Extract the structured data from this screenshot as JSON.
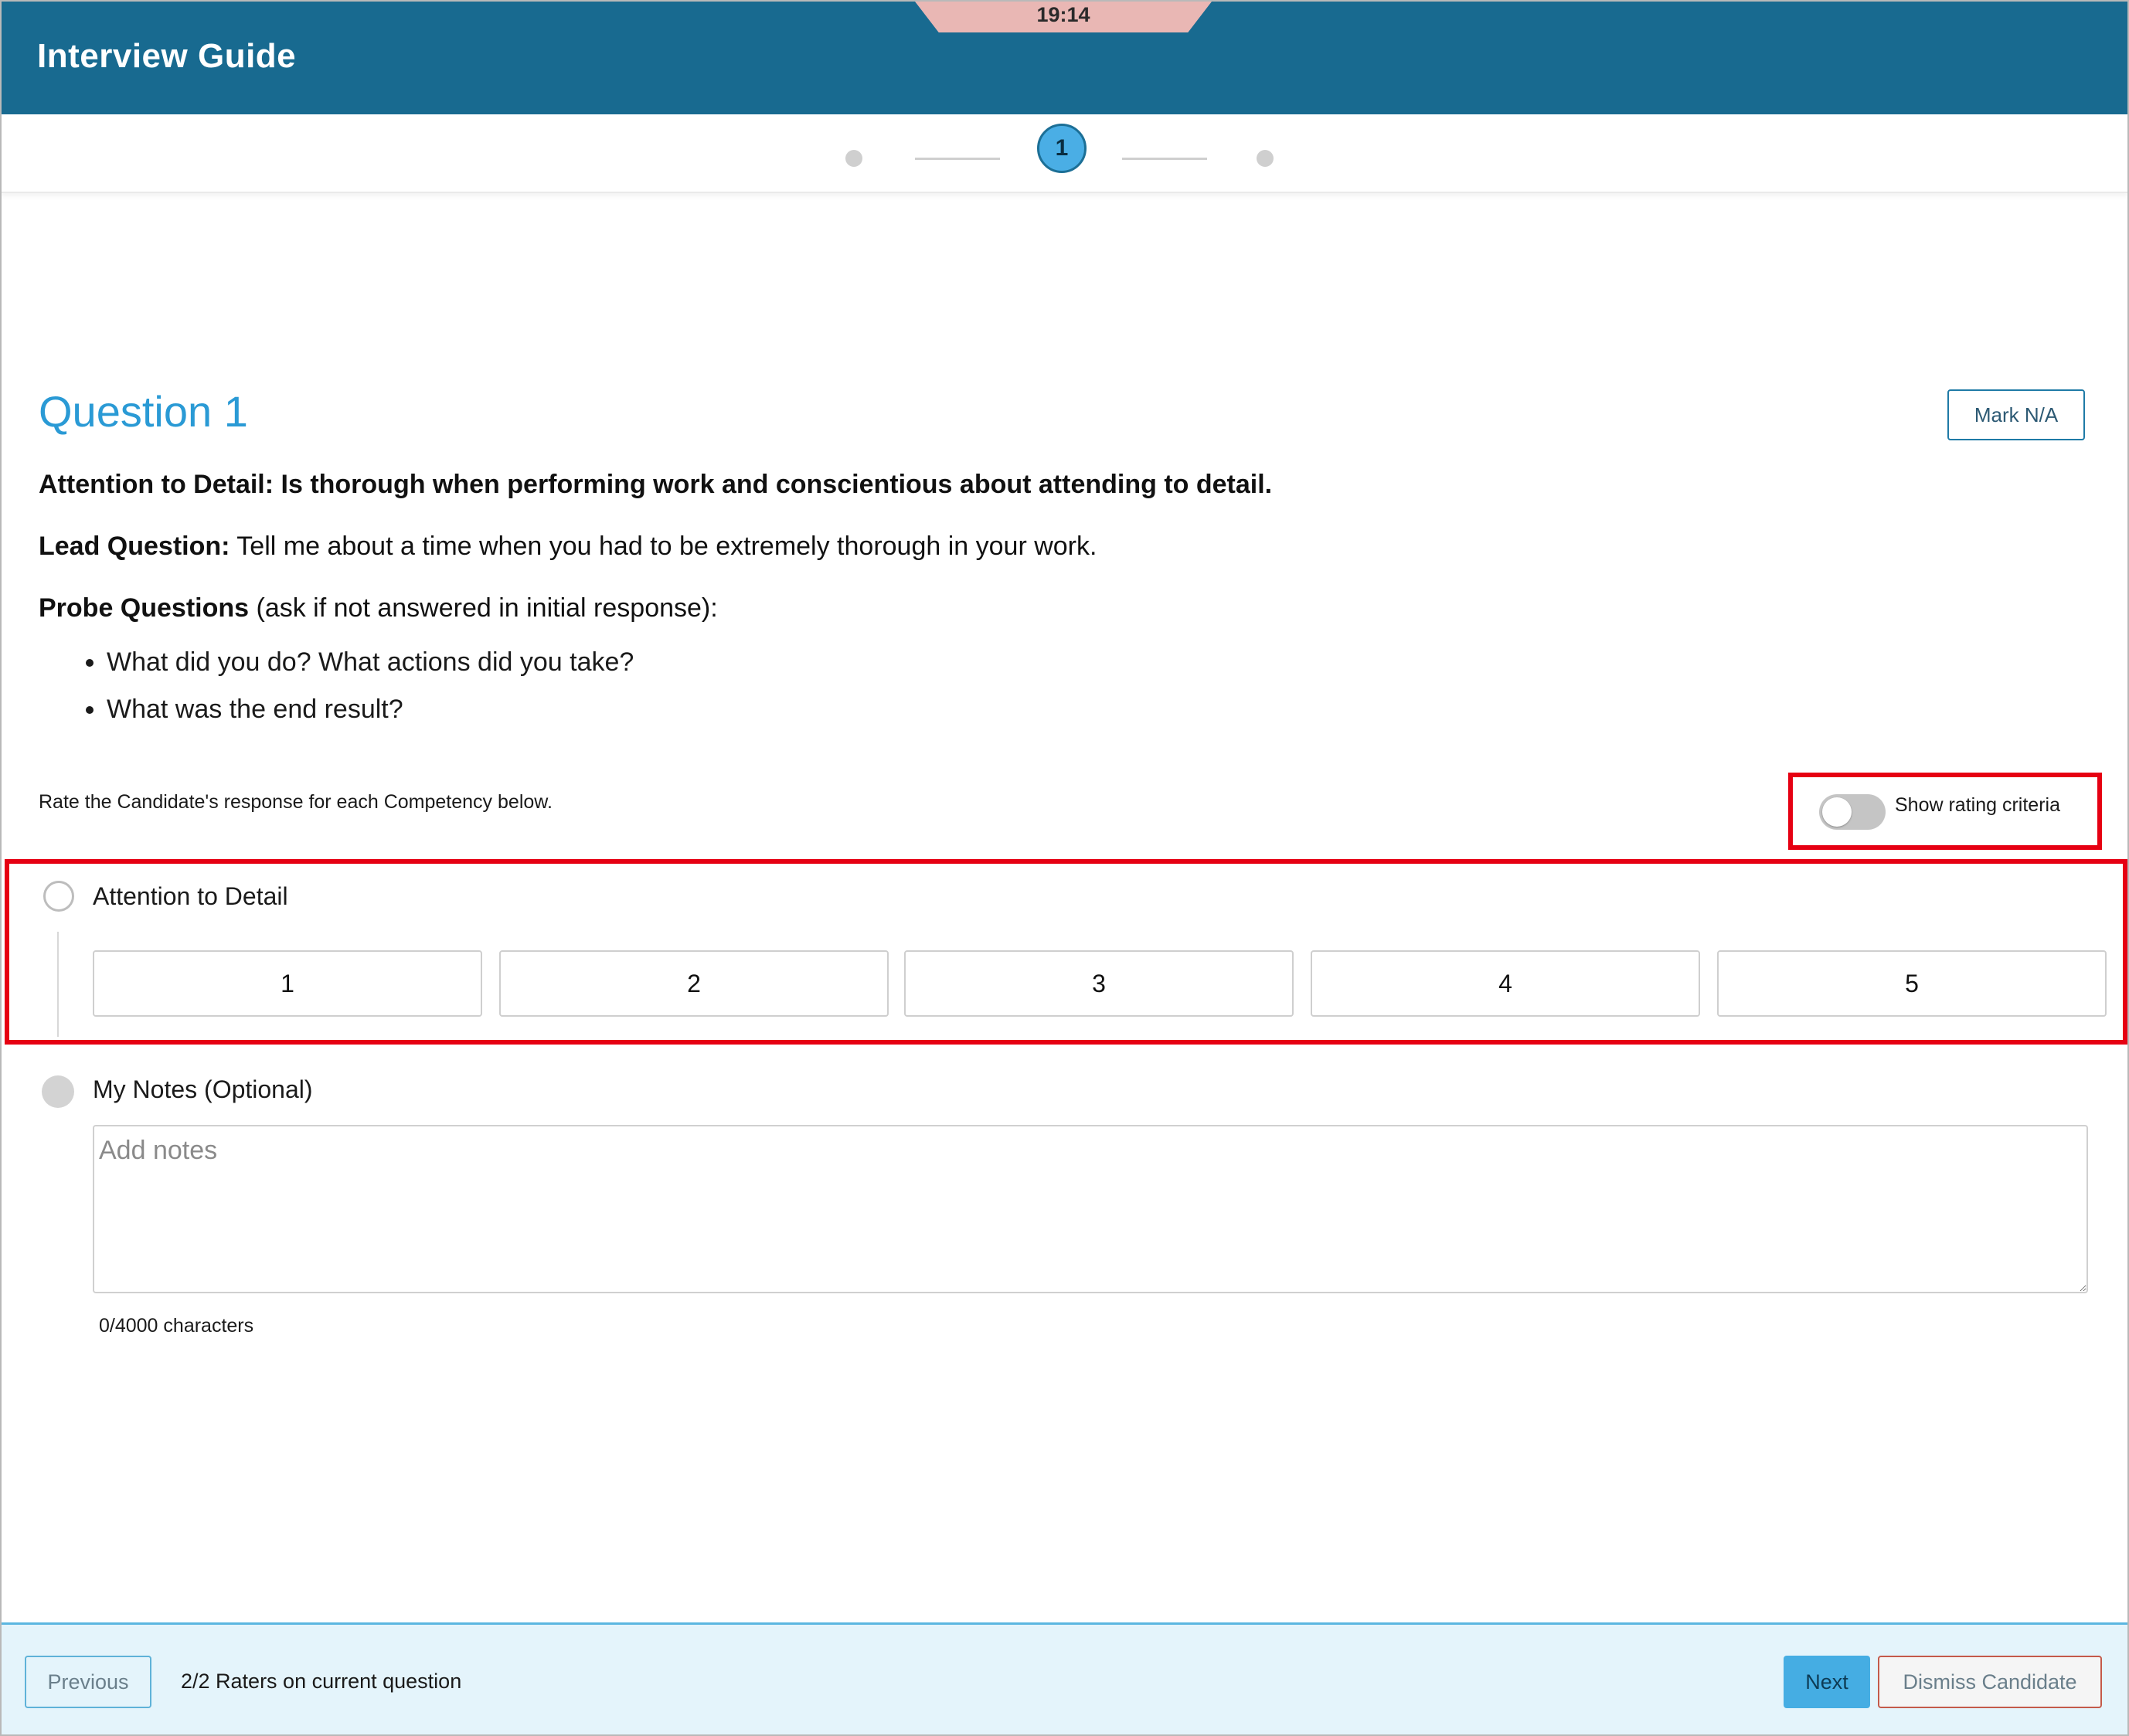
{
  "header": {
    "title": "Interview Guide",
    "timer": "19:14"
  },
  "stepper": {
    "current_step": "1"
  },
  "question": {
    "title": "Question 1",
    "mark_na_label": "Mark N/A",
    "competency_statement": "Attention to Detail: Is thorough when performing work and conscientious about attending to detail.",
    "lead_label": "Lead Question:",
    "lead_text": " Tell me about a time when you had to be extremely thorough in your work.",
    "probe_label": "Probe Questions",
    "probe_text": " (ask if not answered in initial response):",
    "probes": [
      "What did you do? What actions did you take?",
      "What was the end result?"
    ]
  },
  "rating": {
    "instruction": "Rate the Candidate's response for each Competency below.",
    "toggle_label": "Show rating criteria",
    "toggle_on": false,
    "competency_name": "Attention to Detail",
    "scale": [
      "1",
      "2",
      "3",
      "4",
      "5"
    ]
  },
  "notes": {
    "label": "My Notes (Optional)",
    "placeholder": "Add notes",
    "value": "",
    "char_count": "0/4000 characters"
  },
  "footer": {
    "previous_label": "Previous",
    "raters_status": "2/2 Raters on current question",
    "next_label": "Next",
    "dismiss_label": "Dismiss Candidate"
  },
  "colors": {
    "header_bg": "#186a90",
    "accent": "#2a9ad5",
    "highlight": "#e60012"
  }
}
